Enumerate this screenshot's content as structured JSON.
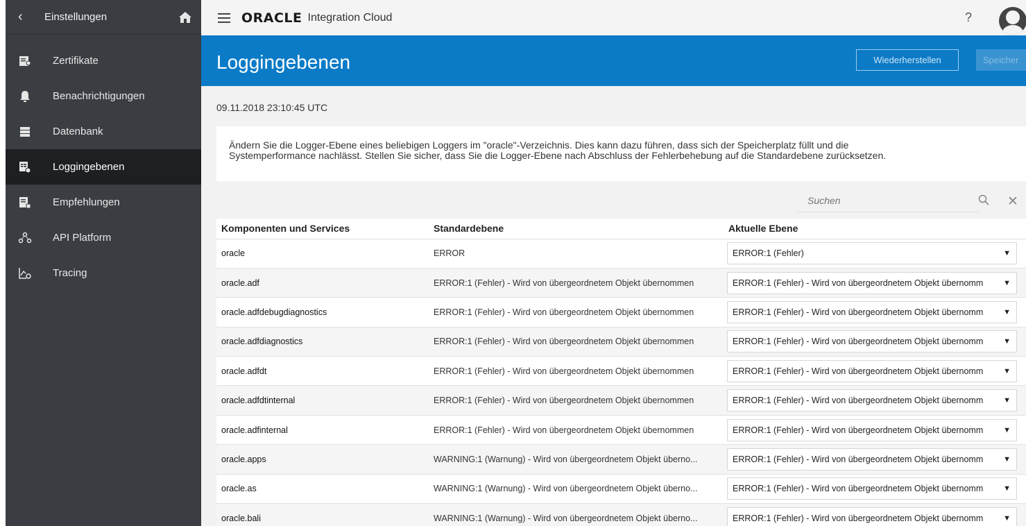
{
  "sidebar": {
    "title": "Einstellungen",
    "items": [
      {
        "label": "Zertifikate",
        "icon": "certificate-icon"
      },
      {
        "label": "Benachrichtigungen",
        "icon": "bell-icon"
      },
      {
        "label": "Datenbank",
        "icon": "database-icon"
      },
      {
        "label": "Loggingebenen",
        "icon": "logging-icon",
        "active": true
      },
      {
        "label": "Empfehlungen",
        "icon": "recommendations-icon"
      },
      {
        "label": "API Platform",
        "icon": "api-icon"
      },
      {
        "label": "Tracing",
        "icon": "tracing-icon"
      }
    ]
  },
  "header": {
    "brand": "ORACLE",
    "product": "Integration Cloud",
    "help": "?"
  },
  "page": {
    "title": "Loggingebenen",
    "restore_label": "Wiederherstellen",
    "save_label": "Speicher",
    "timestamp": "09.11.2018 23:10:45 UTC",
    "description_line1": "Ändern Sie die Logger-Ebene eines beliebigen Loggers im \"oracle\"-Verzeichnis. Dies kann dazu führen, dass sich der Speicherplatz füllt und die",
    "description_line2": "Systemperformance nachlässt. Stellen Sie sicher, dass Sie die Logger-Ebene nach Abschluss der Fehlerbehebung auf die Standardebene zurücksetzen."
  },
  "search": {
    "placeholder": "Suchen"
  },
  "table": {
    "columns": [
      "Komponenten und Services",
      "Standardebene",
      "Aktuelle Ebene"
    ],
    "rows": [
      {
        "component": "oracle",
        "default": "ERROR",
        "current": "ERROR:1 (Fehler)"
      },
      {
        "component": "oracle.adf",
        "default": "ERROR:1 (Fehler) - Wird von übergeordnetem Objekt übernommen",
        "current": "ERROR:1 (Fehler) - Wird von übergeordnetem Objekt übernomm"
      },
      {
        "component": "oracle.adfdebugdiagnostics",
        "default": "ERROR:1 (Fehler) - Wird von übergeordnetem Objekt übernommen",
        "current": "ERROR:1 (Fehler) - Wird von übergeordnetem Objekt übernomm"
      },
      {
        "component": "oracle.adfdiagnostics",
        "default": "ERROR:1 (Fehler) - Wird von übergeordnetem Objekt übernommen",
        "current": "ERROR:1 (Fehler) - Wird von übergeordnetem Objekt übernomm"
      },
      {
        "component": "oracle.adfdt",
        "default": "ERROR:1 (Fehler) - Wird von übergeordnetem Objekt übernommen",
        "current": "ERROR:1 (Fehler) - Wird von übergeordnetem Objekt übernomm"
      },
      {
        "component": "oracle.adfdtinternal",
        "default": "ERROR:1 (Fehler) - Wird von übergeordnetem Objekt übernommen",
        "current": "ERROR:1 (Fehler) - Wird von übergeordnetem Objekt übernomm"
      },
      {
        "component": "oracle.adfinternal",
        "default": "ERROR:1 (Fehler) - Wird von übergeordnetem Objekt übernommen",
        "current": "ERROR:1 (Fehler) - Wird von übergeordnetem Objekt übernomm"
      },
      {
        "component": "oracle.apps",
        "default": "WARNING:1 (Warnung) - Wird von übergeordnetem Objekt überno...",
        "current": "ERROR:1 (Fehler) - Wird von übergeordnetem Objekt übernomm"
      },
      {
        "component": "oracle.as",
        "default": "WARNING:1 (Warnung) - Wird von übergeordnetem Objekt überno...",
        "current": "ERROR:1 (Fehler) - Wird von übergeordnetem Objekt übernomm"
      },
      {
        "component": "oracle.bali",
        "default": "WARNING:1 (Warnung) - Wird von übergeordnetem Objekt überno...",
        "current": "ERROR:1 (Fehler) - Wird von übergeordnetem Objekt übernomm"
      }
    ]
  },
  "colors": {
    "sidebar_bg": "#3a3d42",
    "sidebar_active_bg": "#1d1f22",
    "page_header_bg": "#0b7bc7",
    "topbar_bg": "#f4f4f4"
  }
}
